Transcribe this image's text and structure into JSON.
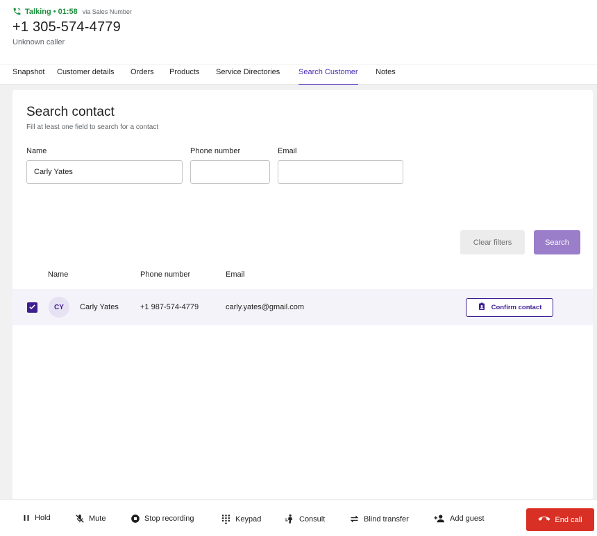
{
  "call": {
    "status": "Talking • 01:58",
    "via": "via Sales Number",
    "phone": "+1 305-574-4779",
    "caller": "Unknown caller"
  },
  "tabs": [
    {
      "label": "Snapshot"
    },
    {
      "label": "Customer details"
    },
    {
      "label": "Orders"
    },
    {
      "label": "Products"
    },
    {
      "label": "Service Directories"
    },
    {
      "label": "Search Customer",
      "active": true
    },
    {
      "label": "Notes"
    }
  ],
  "search": {
    "title": "Search contact",
    "subtitle": "Fill at least one field to search for a contact",
    "fields": {
      "name": {
        "label": "Name",
        "value": "Carly Yates",
        "placeholder": ""
      },
      "phone": {
        "label": "Phone number",
        "value": "",
        "placeholder": ""
      },
      "email": {
        "label": "Email",
        "value": "",
        "placeholder": ""
      }
    },
    "clear_label": "Clear filters",
    "search_label": "Search"
  },
  "results": {
    "columns": [
      "Name",
      "Phone number",
      "Email"
    ],
    "rows": [
      {
        "checked": true,
        "initials": "CY",
        "name": "Carly Yates",
        "phone": "+1 987-574-4779",
        "email": "carly.yates@gmail.com",
        "action": "Confirm contact"
      }
    ]
  },
  "controls": {
    "hold": "Hold",
    "mute": "Mute",
    "stop_recording": "Stop recording",
    "keypad": "Keypad",
    "consult": "Consult",
    "blind_transfer": "Blind transfer",
    "add_guest": "Add guest",
    "end_call": "End call"
  },
  "colors": {
    "accent": "#3d1d8f",
    "active_tab": "#4a2ab6",
    "talking_green": "#1e8e3e",
    "search_button": "#9a7ec9",
    "end_call": "#d93025"
  },
  "icons": [
    "phone-in-talk-icon",
    "check-icon",
    "contact-badge-icon",
    "pause-icon",
    "mic-off-icon",
    "stop-record-icon",
    "keypad-icon",
    "consult-icon",
    "transfer-icon",
    "add-person-icon",
    "hang-up-icon"
  ]
}
